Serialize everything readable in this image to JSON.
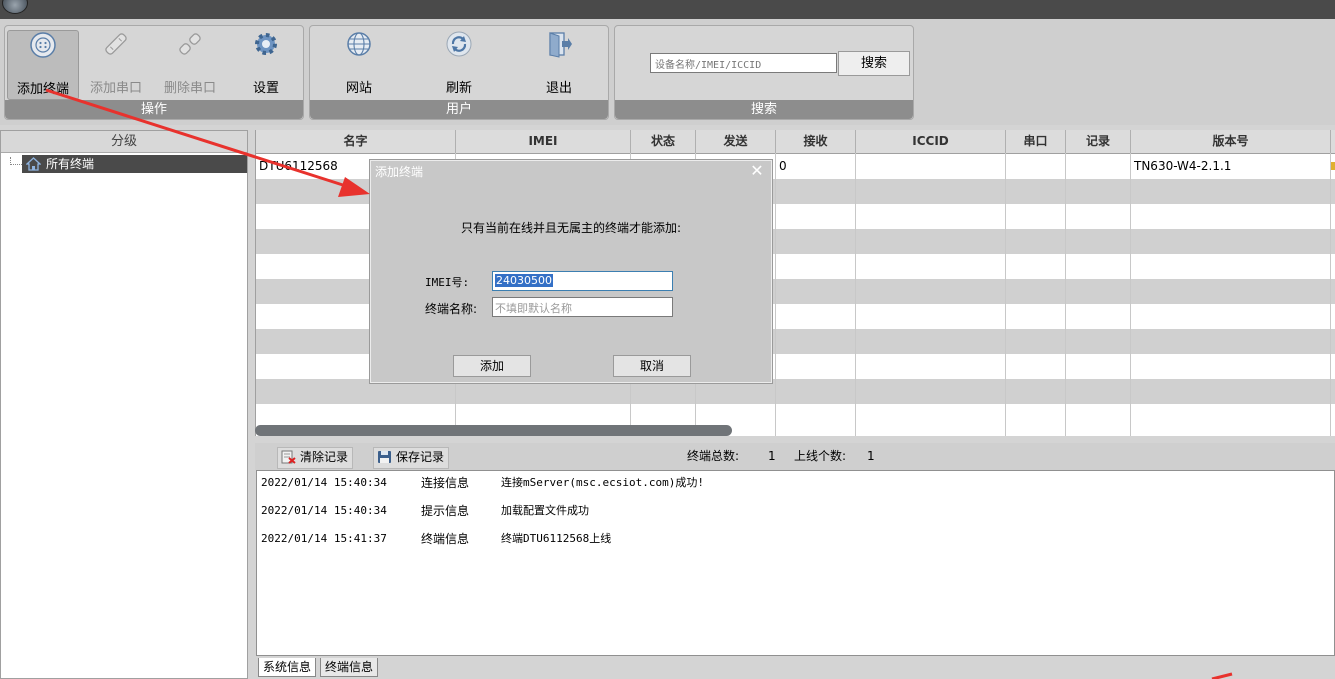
{
  "ribbon": {
    "groups": [
      {
        "label": "操作",
        "buttons": [
          {
            "label": "添加终端",
            "icon": "add-terminal-icon"
          },
          {
            "label": "添加串口",
            "icon": "add-serial-icon"
          },
          {
            "label": "删除串口",
            "icon": "delete-serial-icon"
          },
          {
            "label": "设置",
            "icon": "gear-icon"
          }
        ]
      },
      {
        "label": "用户",
        "buttons": [
          {
            "label": "网站",
            "icon": "globe-icon"
          },
          {
            "label": "刷新",
            "icon": "refresh-icon"
          },
          {
            "label": "退出",
            "icon": "exit-icon"
          }
        ]
      },
      {
        "label": "搜索"
      }
    ],
    "search": {
      "placeholder": "设备名称/IMEI/ICCID",
      "button": "搜索"
    }
  },
  "left_panel": {
    "header": "分级",
    "tree_root": "所有终端"
  },
  "grid": {
    "columns": [
      "名字",
      "IMEI",
      "状态",
      "发送",
      "接收",
      "ICCID",
      "串口",
      "记录",
      "版本号"
    ],
    "rows": [
      {
        "name": "DTU6112568",
        "receive": "0",
        "version": "TN630-W4-2.1.1"
      }
    ]
  },
  "log_toolbar": {
    "clear": "清除记录",
    "save": "保存记录",
    "total_label": "终端总数:",
    "total": "1",
    "online_label": "上线个数:",
    "online": "1"
  },
  "logs": [
    {
      "time": "2022/01/14 15:40:34",
      "type": "连接信息",
      "msg": "连接mServer(msc.ecsiot.com)成功!"
    },
    {
      "time": "2022/01/14 15:40:34",
      "type": "提示信息",
      "msg": "加载配置文件成功"
    },
    {
      "time": "2022/01/14 15:41:37",
      "type": "终端信息",
      "msg": "终端DTU6112568上线"
    }
  ],
  "bottom_tabs": [
    "系统信息",
    "终端信息"
  ],
  "dialog": {
    "title": "添加终端",
    "message": "只有当前在线并且无属主的终端才能添加:",
    "imei_label": "IMEI号:",
    "imei_value": "24030500",
    "name_label": "终端名称:",
    "name_placeholder": "不填即默认名称",
    "add": "添加",
    "cancel": "取消"
  },
  "colors": {
    "arrow": "#e8322d",
    "selection": "#3470c6",
    "group_label_bg": "#8d8d8d"
  }
}
